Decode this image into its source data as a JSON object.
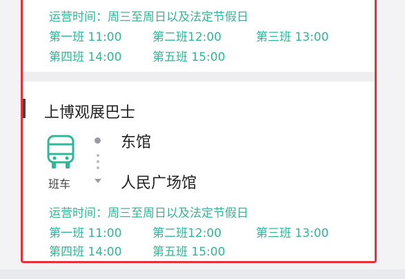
{
  "route_top": {
    "schedule": {
      "hours_line": "运营时间：周三至周日以及法定节假日",
      "trips": [
        "第一班 11:00",
        "第二班12:00",
        "第三班 13:00",
        "第四班 14:00",
        "第五班 15:00"
      ]
    }
  },
  "route_card": {
    "title": "上博观展巴士",
    "vehicle_label": "班车",
    "stops": {
      "origin": "东馆",
      "destination": "人民广场馆"
    },
    "schedule": {
      "hours_line": "运营时间：周三至周日以及法定节假日",
      "trips": [
        "第一班 11:00",
        "第二班12:00",
        "第三班 13:00",
        "第四班 14:00",
        "第五班 15:00"
      ]
    }
  },
  "colors": {
    "highlight_border": "#e5303a",
    "schedule_text": "#2db897",
    "icon": "#2db897"
  },
  "icons": {
    "vehicle": "bus-icon"
  }
}
